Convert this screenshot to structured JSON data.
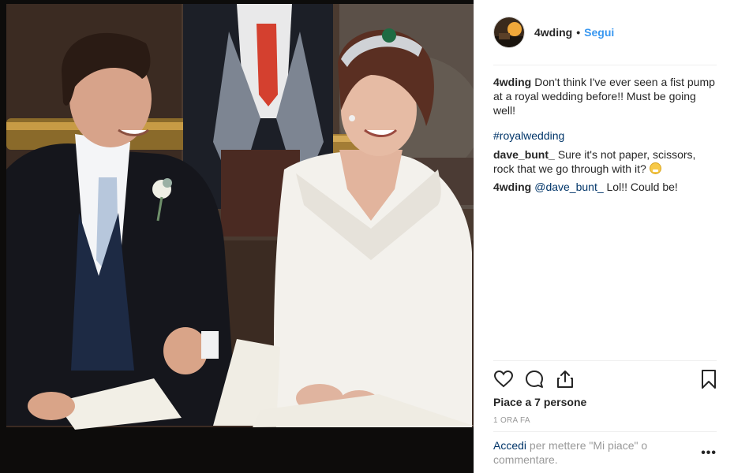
{
  "post": {
    "photo_description": "wedding-photo",
    "author": "4wding",
    "separator": "•",
    "follow_label": "Segui"
  },
  "comments": {
    "caption_user": "4wding",
    "caption_text": "Don't think I've ever seen a fist pump at a royal wedding before!! Must be going well!",
    "hashtag": "#royalwedding",
    "c1_user": "dave_bunt_",
    "c1_text": "Sure it's not paper, scissors, rock that we go through with it?",
    "c2_user": "4wding",
    "c2_mention": "@dave_bunt_",
    "c2_text": "Lol!! Could be!"
  },
  "actions": {
    "like_icon": "heart-icon",
    "comment_icon": "comment-icon",
    "share_icon": "share-icon",
    "save_icon": "bookmark-icon"
  },
  "likes_text": "Piace a 7 persone",
  "timestamp": "1 ORA FA",
  "footer": {
    "login_link": "Accedi",
    "login_text": "per mettere \"Mi piace\" o commentare.",
    "more_label": "•••"
  },
  "colors": {
    "link": "#3897f0",
    "hashtag": "#003569",
    "text": "#262626",
    "muted": "#999999"
  }
}
